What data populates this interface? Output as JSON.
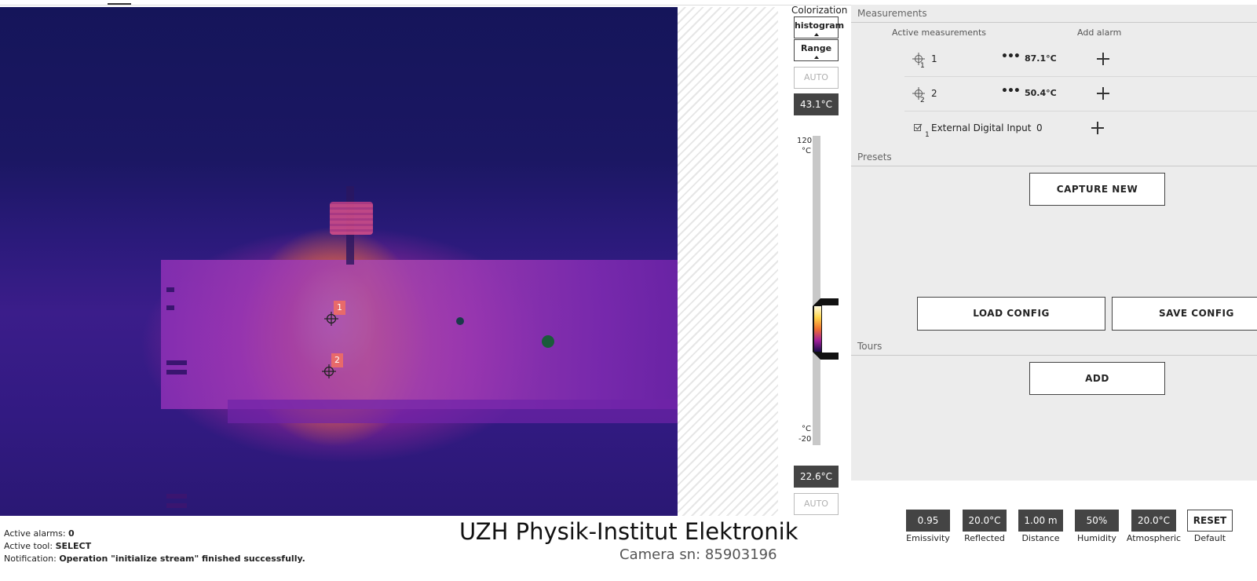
{
  "status": {
    "alarms_label": "Active alarms:",
    "alarms_value": "0",
    "tool_label": "Active tool:",
    "tool_value": "SELECT",
    "notification_label": "Notification:",
    "notification_value": "Operation \"initialize stream\" finished successfully."
  },
  "brand": {
    "title": "UZH Physik-Institut Elektronik",
    "camera_sn": "Camera sn: 85903196"
  },
  "image_markers": [
    {
      "label": "1"
    },
    {
      "label": "2"
    }
  ],
  "colorization": {
    "title": "Colorization",
    "mode_button": "histogram",
    "range_button": "Range",
    "auto_top": "AUTO",
    "max_temp": "43.1°C",
    "scale_max": "120",
    "scale_unit": "°C",
    "scale_min": "-20",
    "min_temp": "22.6°C",
    "auto_bottom": "AUTO"
  },
  "measurements": {
    "title": "Measurements",
    "active_header": "Active measurements",
    "alarm_header": "Add alarm",
    "rows": [
      {
        "index": "1",
        "name": "1",
        "menu": "•••",
        "value": "87.1°C",
        "icon": "spot-measurement-icon"
      },
      {
        "index": "2",
        "name": "2",
        "menu": "•••",
        "value": "50.4°C",
        "icon": "spot-measurement-icon"
      },
      {
        "index": "1",
        "name": "External Digital Input",
        "value": "0",
        "icon": "digital-input-icon"
      }
    ]
  },
  "presets": {
    "title": "Presets",
    "capture_button": "CAPTURE NEW",
    "load_button": "LOAD CONFIG",
    "save_button": "SAVE CONFIG"
  },
  "tours": {
    "title": "Tours",
    "add_button": "ADD"
  },
  "params": [
    {
      "value": "0.95",
      "label": "Emissivity"
    },
    {
      "value": "20.0°C",
      "label": "Reflected"
    },
    {
      "value": "1.00 m",
      "label": "Distance"
    },
    {
      "value": "50%",
      "label": "Humidity"
    },
    {
      "value": "20.0°C",
      "label": "Atmospheric"
    }
  ],
  "reset": {
    "button": "RESET",
    "label": "Default"
  },
  "colors": {
    "panel_bg": "#ececec",
    "dark_box": "#444444",
    "marker": "#e86a6a"
  }
}
